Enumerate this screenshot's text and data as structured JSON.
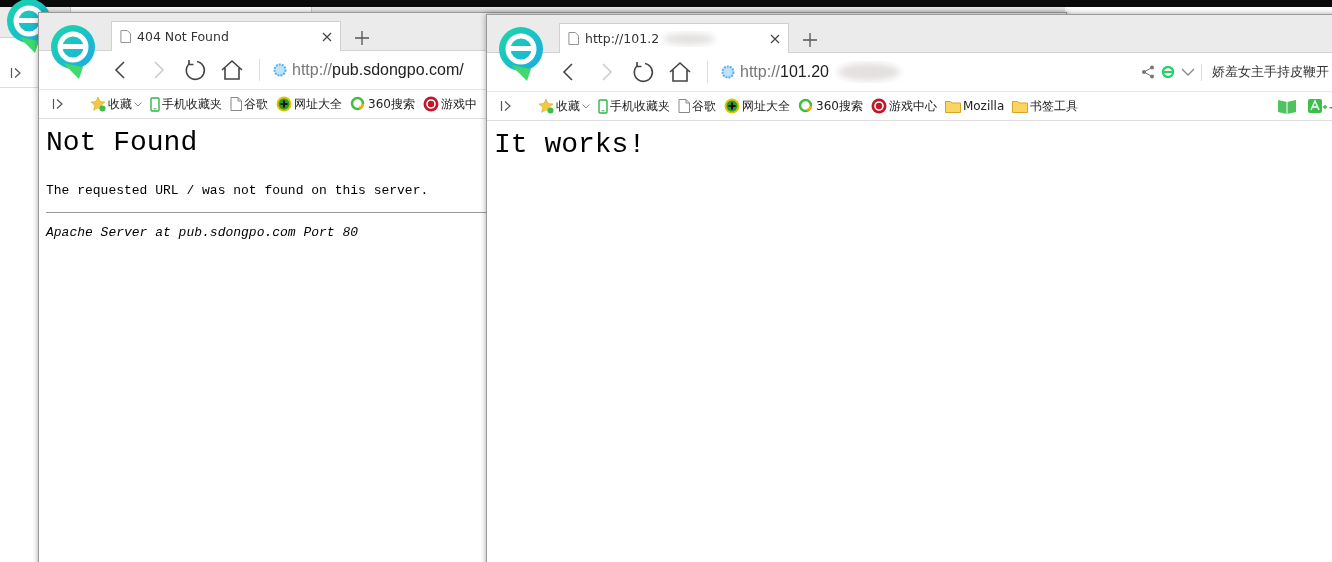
{
  "windows": [
    {
      "tab": {
        "title": "404 Not Found",
        "selected": true,
        "redacted": false
      },
      "address": {
        "scheme": "http://",
        "host": "pub.sdongpo.com/",
        "redacted": false
      },
      "bookmarks": [
        {
          "label": "收藏",
          "kind": "favorites"
        },
        {
          "label": "手机收藏夹",
          "kind": "phone"
        },
        {
          "label": "谷歌",
          "kind": "page"
        },
        {
          "label": "网址大全",
          "kind": "plus"
        },
        {
          "label": "360搜索",
          "kind": "ring"
        },
        {
          "label": "游戏中",
          "kind": "game"
        }
      ],
      "content": [
        {
          "kind": "heading",
          "text": "Not Found"
        },
        {
          "kind": "paragraph",
          "text": "The requested URL / was not found on this server."
        },
        {
          "kind": "rule"
        },
        {
          "kind": "address",
          "text": "Apache Server at pub.sdongpo.com Port 80"
        }
      ]
    },
    {
      "tab": {
        "title": "http://101.2",
        "selected": true,
        "redacted": true
      },
      "address": {
        "scheme": "http://",
        "host": "101.20",
        "redacted": true
      },
      "tools": {
        "headline": "娇羞女主手持皮鞭开"
      },
      "bookmarks": [
        {
          "label": "收藏",
          "kind": "favorites"
        },
        {
          "label": "手机收藏夹",
          "kind": "phone"
        },
        {
          "label": "谷歌",
          "kind": "page"
        },
        {
          "label": "网址大全",
          "kind": "plus"
        },
        {
          "label": "360搜索",
          "kind": "ring"
        },
        {
          "label": "游戏中心",
          "kind": "game"
        },
        {
          "label": "Mozilla",
          "kind": "folder"
        },
        {
          "label": "书签工具",
          "kind": "folder"
        }
      ],
      "content": [
        {
          "kind": "heading",
          "text": "It works!"
        }
      ]
    }
  ]
}
